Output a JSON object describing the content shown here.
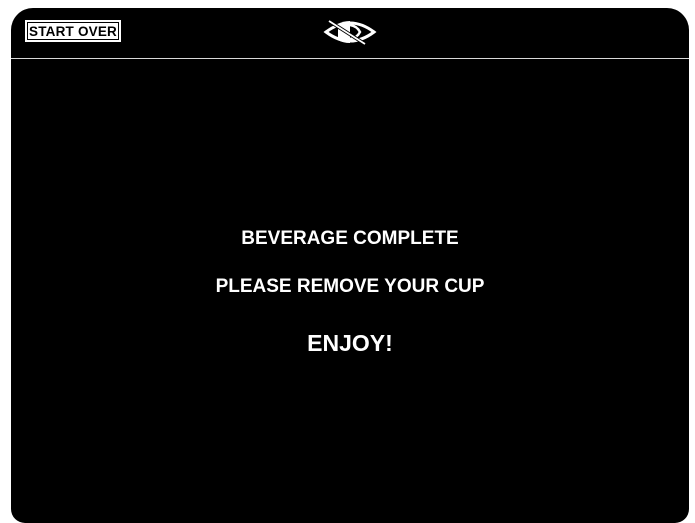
{
  "header": {
    "start_over_label": "START OVER",
    "logo_icon": "eye-logo-icon"
  },
  "main": {
    "line1": "BEVERAGE COMPLETE",
    "line2": "PLEASE REMOVE YOUR CUP",
    "line3": "ENJOY!"
  },
  "colors": {
    "background": "#000000",
    "text": "#ffffff",
    "divider": "#d9d9d9"
  }
}
